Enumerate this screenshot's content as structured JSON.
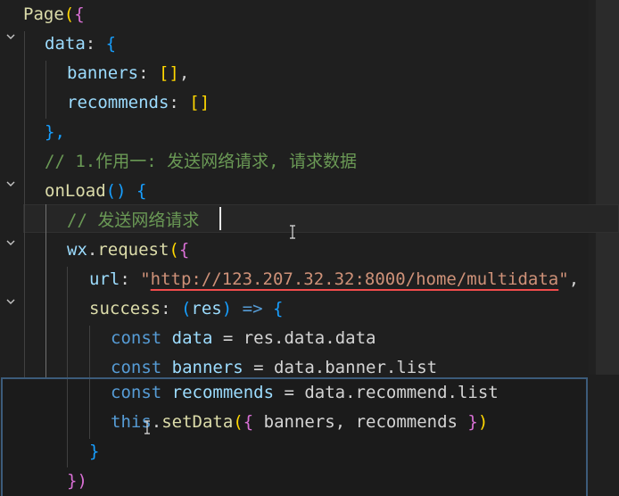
{
  "code": {
    "l1": {
      "fn": "Page",
      "open": "(",
      "brace": "{"
    },
    "l2": {
      "key": "data",
      "colon": ": ",
      "brace": "{"
    },
    "l3": {
      "key": "banners",
      "colon": ": ",
      "val": "[]",
      "comma": ","
    },
    "l4": {
      "key": "recommends",
      "colon": ": ",
      "val": "[]"
    },
    "l5": {
      "text": "},"
    },
    "l6": {
      "comment": "// 1.作用一: 发送网络请求, 请求数据"
    },
    "l7": {
      "fn": "onLoad",
      "parens": "()",
      "brace": "{"
    },
    "l8": {
      "comment": "// 发送网络请求"
    },
    "l9": {
      "obj": "wx",
      "dot": ".",
      "fn": "request",
      "open": "(",
      "brace": "{"
    },
    "l10": {
      "key": "url",
      "colon": ": ",
      "q1": "\"",
      "url": "http://123.207.32.32:8000/home/multidata",
      "q2": "\"",
      "comma": ","
    },
    "l11": {
      "key": "success",
      "colon": ": ",
      "popen": "(",
      "param": "res",
      "pclose": ")",
      "arrow": " => ",
      "brace": "{"
    },
    "l12": {
      "kw": "const",
      "sp": " ",
      "var": "data",
      "rest": " = res.data.data"
    },
    "l13": {
      "kw": "const",
      "sp": " ",
      "var": "banners",
      "rest": " = data.banner.list"
    },
    "l14": {
      "kw": "const",
      "sp": " ",
      "var": "recommends",
      "rest": " = data.recommend.list"
    },
    "l15": {
      "kw": "this",
      "dot": ".",
      "fn": "setData",
      "open": "(",
      "brace": "{",
      "args": " banners, recommends ",
      "bclose": "}",
      "close": ")"
    },
    "l16": {
      "brace": "}"
    },
    "l17": {
      "text": "})"
    }
  },
  "colors": {
    "background": "#1f1f1f",
    "function": "#dcdcaa",
    "property": "#9cdcfe",
    "keyword": "#569cd6",
    "string": "#ce9178",
    "comment": "#6a9955",
    "bracket_level1": "#ffd700",
    "bracket_level2": "#da70d6",
    "bracket_level3": "#179fff",
    "error_underline": "#f14c4c"
  },
  "icons": [
    "chevron-down-icon",
    "text-cursor-icon"
  ]
}
